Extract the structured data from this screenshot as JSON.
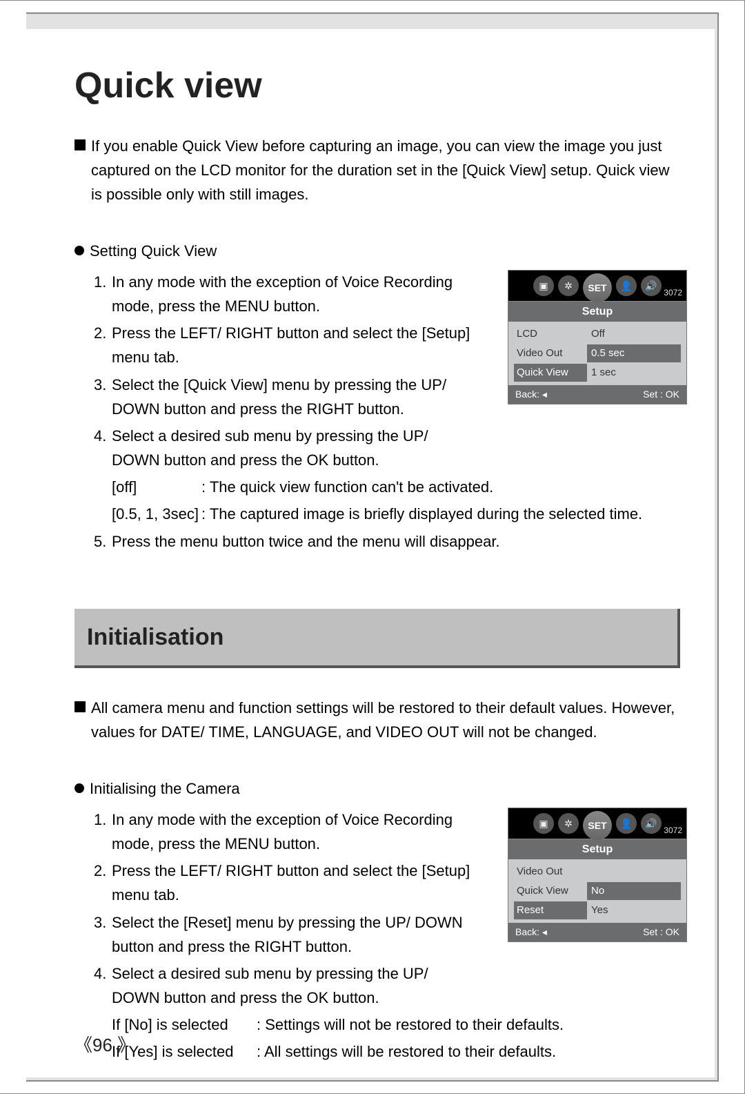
{
  "page": {
    "title": "Quick view",
    "number_display": "《96 》"
  },
  "intro": "If you enable Quick View before capturing an image, you can view the image you just captured on the LCD monitor for the duration set in the [Quick View] setup. Quick view is possible only with still images.",
  "qv": {
    "heading": "Setting Quick View",
    "steps": {
      "s1": "In any mode with the exception of Voice Recording mode, press the MENU button.",
      "s2": "Press the LEFT/ RIGHT button and select the [Setup] menu tab.",
      "s3": "Select the [Quick View] menu by pressing the UP/ DOWN button and press the RIGHT button.",
      "s4": "Select a desired sub menu by pressing the UP/ DOWN button and press the OK button.",
      "opt_off_label": "[off]",
      "opt_off_desc": ": The quick view function can't be activated.",
      "opt_time_label": "[0.5, 1, 3sec]",
      "opt_time_desc": ": The captured image is briefly displayed during the selected time.",
      "s5": "Press the menu button twice and the menu will disappear."
    }
  },
  "init": {
    "section_title": "Initialisation",
    "intro": "All camera menu and function settings will be restored to their default values. However, values for DATE/ TIME, LANGUAGE, and VIDEO OUT will not be changed.",
    "heading": "Initialising the Camera",
    "steps": {
      "s1": "In any mode with the exception of Voice Recording mode, press the MENU button.",
      "s2": "Press the LEFT/ RIGHT button and select the [Setup] menu tab.",
      "s3": "Select the [Reset] menu by pressing the UP/ DOWN button and press the RIGHT button.",
      "s4": "Select a desired sub menu by pressing the UP/ DOWN button and press the OK button.",
      "opt_no_label": "If [No] is selected",
      "opt_no_desc": ": Settings will not be restored to their defaults.",
      "opt_yes_label": "If [Yes] is selected",
      "opt_yes_desc": ": All settings will be restored to their defaults."
    }
  },
  "lcd1": {
    "center_label": "SET",
    "res": "3072",
    "tab": "Setup",
    "rows": {
      "r1l": "LCD",
      "r1r": "Off",
      "r2l": "Video Out",
      "r2r": "0.5 sec",
      "r3l": "Quick View",
      "r3r": "1 sec"
    },
    "back": "Back:",
    "set": "Set : OK"
  },
  "lcd2": {
    "center_label": "SET",
    "res": "3072",
    "tab": "Setup",
    "rows": {
      "r1l": "Video Out",
      "r1r": "",
      "r2l": "Quick View",
      "r2r": "No",
      "r3l": "Reset",
      "r3r": "Yes"
    },
    "back": "Back:",
    "set": "Set : OK"
  },
  "nums": {
    "n1": "1.",
    "n2": "2.",
    "n3": "3.",
    "n4": "4.",
    "n5": "5."
  }
}
